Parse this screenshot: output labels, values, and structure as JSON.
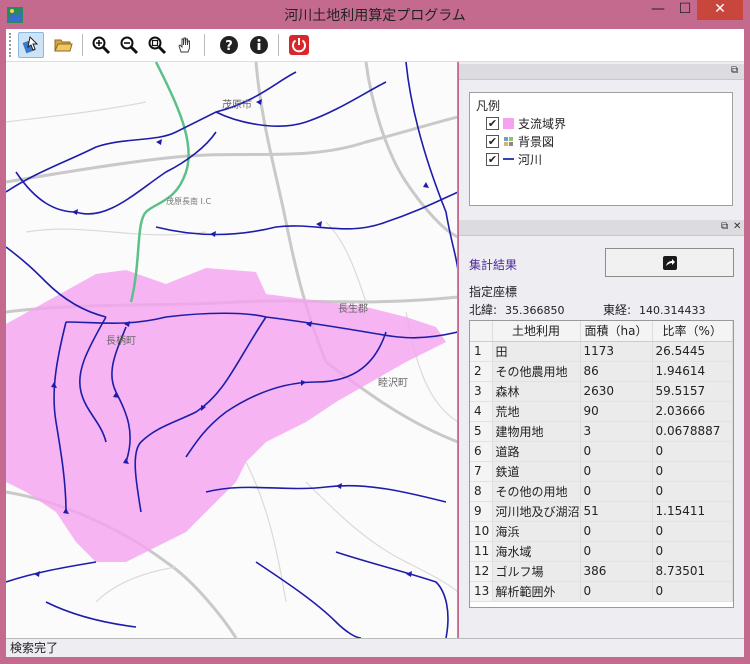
{
  "window": {
    "title": "河川土地利用算定プログラム",
    "min_symbol": "—",
    "max_symbol": "☐",
    "close_symbol": "✕"
  },
  "toolbar": {
    "buttons": [
      {
        "name": "select-tool-button",
        "icon": "select-icon"
      },
      {
        "name": "open-folder-button",
        "icon": "folder-icon"
      },
      {
        "name": "zoom-in-button",
        "icon": "zoom-in-icon"
      },
      {
        "name": "zoom-out-button",
        "icon": "zoom-out-icon"
      },
      {
        "name": "zoom-full-button",
        "icon": "zoom-full-icon"
      },
      {
        "name": "pan-button",
        "icon": "hand-icon"
      },
      {
        "name": "help-button",
        "icon": "question-icon"
      },
      {
        "name": "info-button",
        "icon": "info-icon"
      },
      {
        "name": "exit-button",
        "icon": "power-icon"
      }
    ]
  },
  "map": {
    "labels": [
      "茂原市",
      "長生郡",
      "睦沢町",
      "長柄町",
      "茂原長南 I.C"
    ]
  },
  "legend": {
    "title": "凡例",
    "items": [
      {
        "label": "支流域界",
        "checked": true,
        "color": "#f5a3f0"
      },
      {
        "label": "背景図",
        "checked": true
      },
      {
        "label": "河川",
        "checked": true,
        "color": "#3344bb"
      }
    ]
  },
  "results": {
    "title": "集計結果",
    "coord_title": "指定座標",
    "lat_label": "北緯:",
    "lat_value": "35.366850",
    "lon_label": "東経:",
    "lon_value": "140.314433",
    "columns": [
      "",
      "土地利用",
      "面積（ha）",
      "比率（%）"
    ],
    "rows": [
      {
        "no": "1",
        "use": "田",
        "area": "1173",
        "ratio": "26.5445"
      },
      {
        "no": "2",
        "use": "その他農用地",
        "area": "86",
        "ratio": "1.94614"
      },
      {
        "no": "3",
        "use": "森林",
        "area": "2630",
        "ratio": "59.5157"
      },
      {
        "no": "4",
        "use": "荒地",
        "area": "90",
        "ratio": "2.03666"
      },
      {
        "no": "5",
        "use": "建物用地",
        "area": "3",
        "ratio": "0.0678887"
      },
      {
        "no": "6",
        "use": "道路",
        "area": "0",
        "ratio": "0"
      },
      {
        "no": "7",
        "use": "鉄道",
        "area": "0",
        "ratio": "0"
      },
      {
        "no": "8",
        "use": "その他の用地",
        "area": "0",
        "ratio": "0"
      },
      {
        "no": "9",
        "use": "河川地及び湖沼",
        "area": "51",
        "ratio": "1.15411"
      },
      {
        "no": "10",
        "use": "海浜",
        "area": "0",
        "ratio": "0"
      },
      {
        "no": "11",
        "use": "海水域",
        "area": "0",
        "ratio": "0"
      },
      {
        "no": "12",
        "use": "ゴルフ場",
        "area": "386",
        "ratio": "8.73501"
      },
      {
        "no": "13",
        "use": "解析範囲外",
        "area": "0",
        "ratio": "0"
      }
    ]
  },
  "status": {
    "text": "検索完了"
  },
  "colors": {
    "window_frame": "#c46a8f",
    "watershed_fill": "#f5a3f0",
    "river": "#1d1daa",
    "highway": "#5cc08a"
  }
}
